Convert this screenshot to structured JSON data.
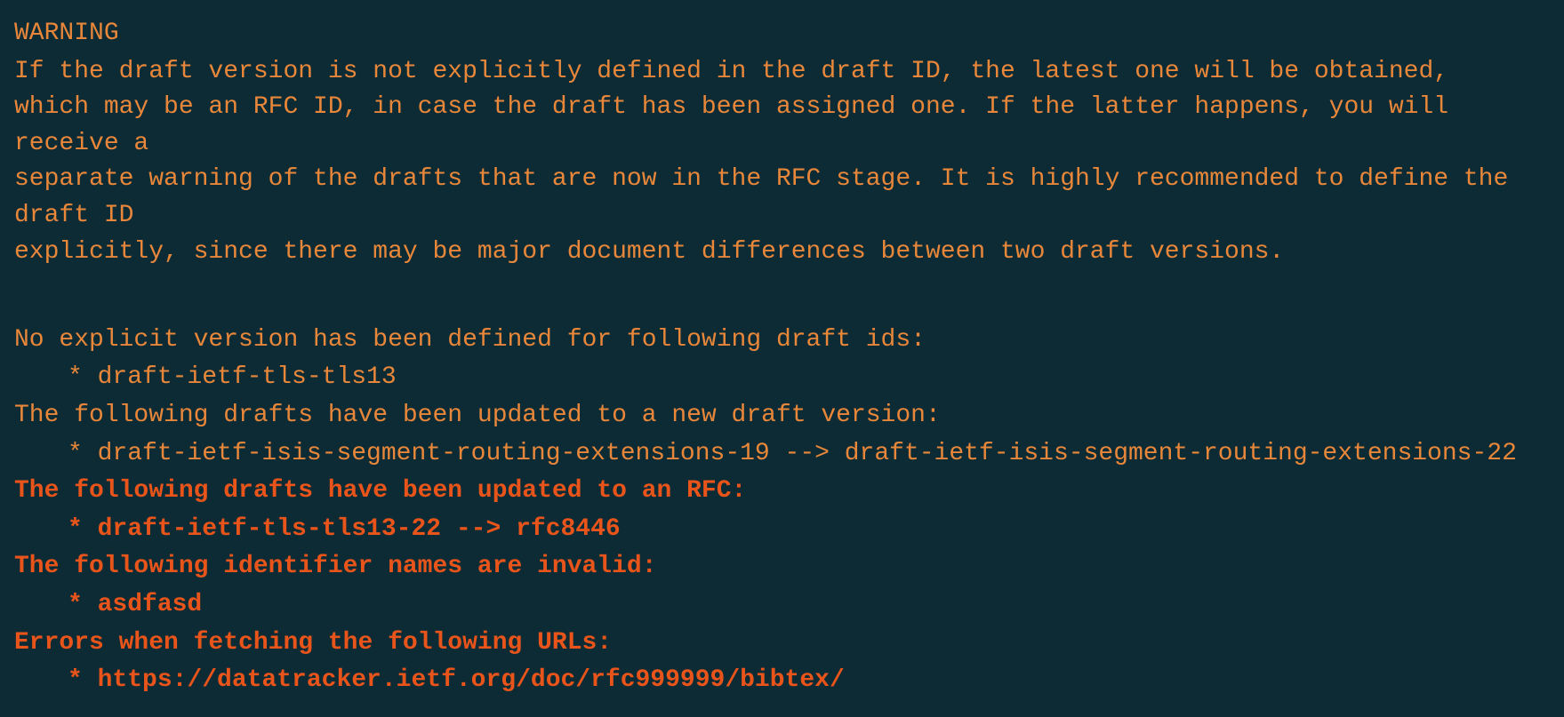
{
  "terminal": {
    "background": "#0d2b35",
    "text_color": "#e8873a",
    "error_color": "#e8541a",
    "warning_label": "WARNING",
    "warning_lines": [
      "If the draft version is not explicitly defined in the draft ID, the latest one will be obtained,",
      "which may be an RFC ID, in case the draft has been assigned one. If the latter happens, you will receive a",
      "separate warning of the drafts that are now in the RFC stage. It is highly recommended to define the draft ID",
      "explicitly, since there may be major document differences between two draft versions."
    ],
    "sections": [
      {
        "type": "normal",
        "label": "No explicit version has been defined for following draft ids:",
        "items": [
          {
            "type": "normal",
            "text": "* draft-ietf-tls-tls13"
          }
        ]
      },
      {
        "type": "normal",
        "label": "The following drafts have been updated to a new draft version:",
        "items": [
          {
            "type": "normal",
            "text": "* draft-ietf-isis-segment-routing-extensions-19 --> draft-ietf-isis-segment-routing-extensions-22"
          }
        ]
      },
      {
        "type": "error",
        "label": "The following drafts have been updated to an RFC:",
        "items": [
          {
            "type": "error",
            "text": "* draft-ietf-tls-tls13-22 --> rfc8446"
          }
        ]
      },
      {
        "type": "error",
        "label": "The following identifier names are invalid:",
        "items": [
          {
            "type": "error",
            "text": "* asdfasd"
          }
        ]
      },
      {
        "type": "error",
        "label": "Errors when fetching the following URLs:",
        "items": [
          {
            "type": "error",
            "text": "* https://datatracker.ietf.org/doc/rfc999999/bibtex/"
          }
        ]
      }
    ]
  }
}
